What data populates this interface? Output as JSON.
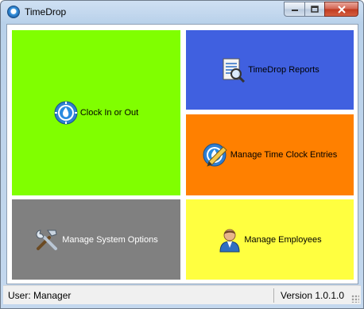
{
  "window": {
    "title": "TimeDrop"
  },
  "controls": {
    "minimize": "▁",
    "maximize": "☐",
    "close": "✕"
  },
  "tiles": [
    {
      "key": "clock",
      "label": "Clock In or Out",
      "icon": "timedrop-clock-icon",
      "color": "#80ff00"
    },
    {
      "key": "reports",
      "label": "TimeDrop Reports",
      "icon": "report-magnifier-icon",
      "color": "#4060e0"
    },
    {
      "key": "entries",
      "label": "Manage Time Clock Entries",
      "icon": "clock-pencil-icon",
      "color": "#ff8000"
    },
    {
      "key": "system",
      "label": "Manage System Options",
      "icon": "tools-icon",
      "color": "#808080"
    },
    {
      "key": "employees",
      "label": "Manage Employees",
      "icon": "employee-icon",
      "color": "#ffff40"
    }
  ],
  "status": {
    "user": "User: Manager",
    "version": "Version 1.0.1.0"
  }
}
